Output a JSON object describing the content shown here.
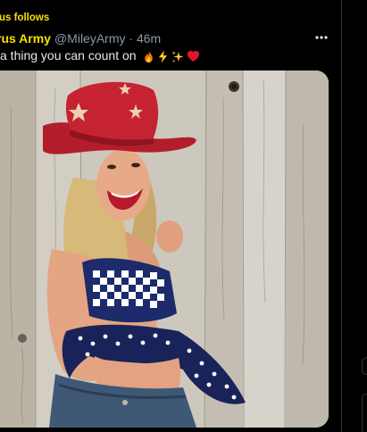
{
  "tweet": {
    "social_context": "us follows",
    "display_name": "rus Army",
    "handle": "@MileyArmy",
    "separator": "·",
    "time": "46m",
    "text": "a thing you can count on",
    "emojis": [
      "fire-emoji",
      "lightning-emoji",
      "sparkles-emoji",
      "red-heart-emoji"
    ],
    "more_icon": "more-horizontal-icon"
  },
  "colors": {
    "background": "#000000",
    "name_highlight": "#f5e000",
    "secondary_text": "#8b98a5",
    "primary_text": "#e7e9ea",
    "divider": "#2f3336"
  }
}
